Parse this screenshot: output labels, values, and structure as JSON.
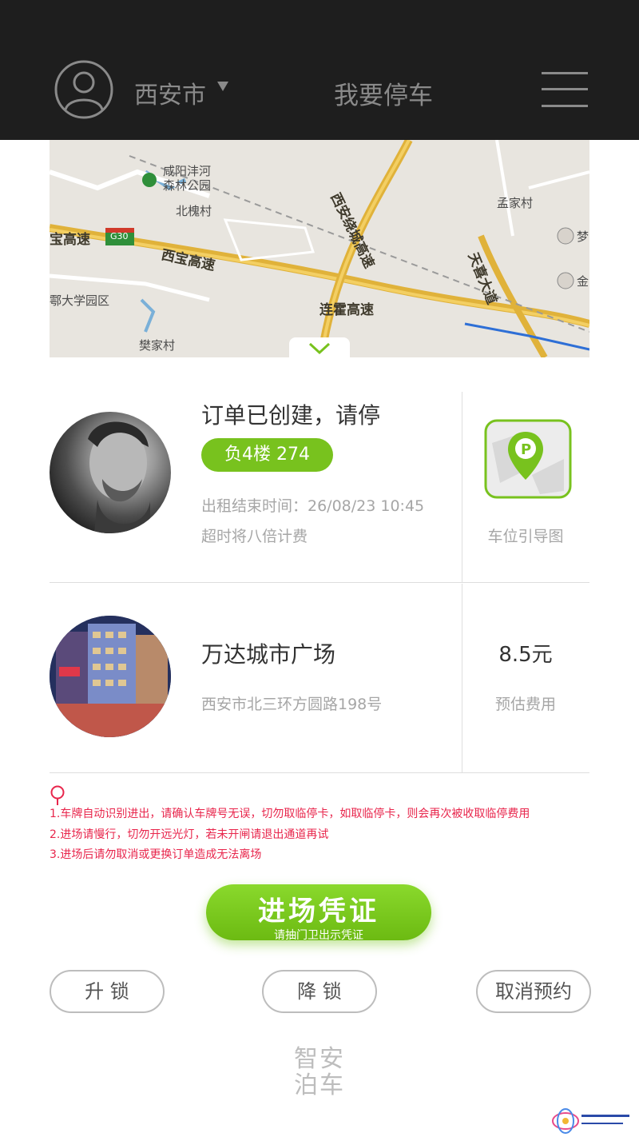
{
  "header": {
    "city": "西安市",
    "title": "我要停车"
  },
  "map": {
    "labels": {
      "park": "咸阳沣河\n森林公园",
      "beihuai": "北槐村",
      "mengjia": "孟家村",
      "daxue": "鄠大学园区",
      "fanjia": "樊家村",
      "g30": "G30",
      "xibao_left": "宝高速",
      "xibao": "西宝高速",
      "raocheng": "西安绕城高速",
      "lianhuo": "连霍高速",
      "tianxi": "天喜大道",
      "meng": "梦",
      "jin": "金"
    }
  },
  "order": {
    "status": "订单已创建，请停",
    "spot": "负4楼   274",
    "end_time": "出租结束时间：26/08/23  10:45",
    "overtime": "超时将八倍计费",
    "guide_label": "车位引导图"
  },
  "parking_lot": {
    "name": "万达城市广场",
    "address": "西安市北三环方圆路198号",
    "fee": "8.5元",
    "fee_label": "预估费用"
  },
  "notes": [
    "1.车牌自动识别进出，请确认车牌号无误，切勿取临停卡，如取临停卡，则会再次被收取临停费用",
    "2.进场请慢行，切勿开远光灯，若未开闸请退出通道再试",
    "3.进场后请勿取消或更换订单造成无法离场"
  ],
  "actions": {
    "enter_main": "进场凭证",
    "enter_sub": "请抽门卫出示凭证",
    "unlock": "升  锁",
    "lock": "降  锁",
    "cancel": "取消预约"
  },
  "footer": {
    "logo_line1": "智安",
    "logo_line2": "泊车"
  },
  "colors": {
    "accent_green": "#78c21e",
    "note_red": "#e8264c",
    "topbar": "#1e1e1e"
  }
}
